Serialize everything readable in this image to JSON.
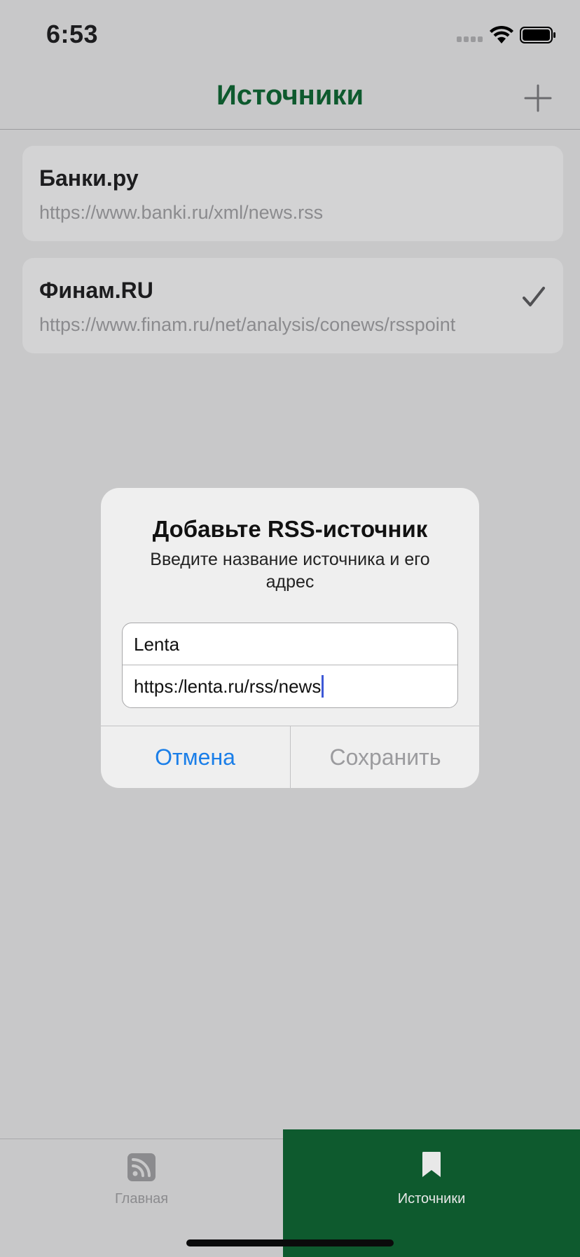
{
  "status_bar": {
    "time": "6:53"
  },
  "nav": {
    "title": "Источники",
    "add_icon": "plus-icon"
  },
  "sources": [
    {
      "title": "Банки.ру",
      "url": "https://www.banki.ru/xml/news.rss",
      "selected": false
    },
    {
      "title": "Финам.RU",
      "url": "https://www.finam.ru/net/analysis/conews/rsspoint",
      "selected": true
    }
  ],
  "alert": {
    "title": "Добавьте RSS-источник",
    "message": "Введите название источника и его адрес",
    "name_value": "Lenta",
    "url_value": "https:/lenta.ru/rss/news",
    "cancel_label": "Отмена",
    "save_label": "Сохранить"
  },
  "tabs": [
    {
      "label": "Главная",
      "icon": "rss-icon",
      "active": false
    },
    {
      "label": "Источники",
      "icon": "bookmark-icon",
      "active": true
    }
  ],
  "colors": {
    "accent_green": "#0e5a2e",
    "link_blue": "#1a7ee8",
    "caret_blue": "#3d58d6",
    "dimmed_background": "#c8c8c9"
  }
}
